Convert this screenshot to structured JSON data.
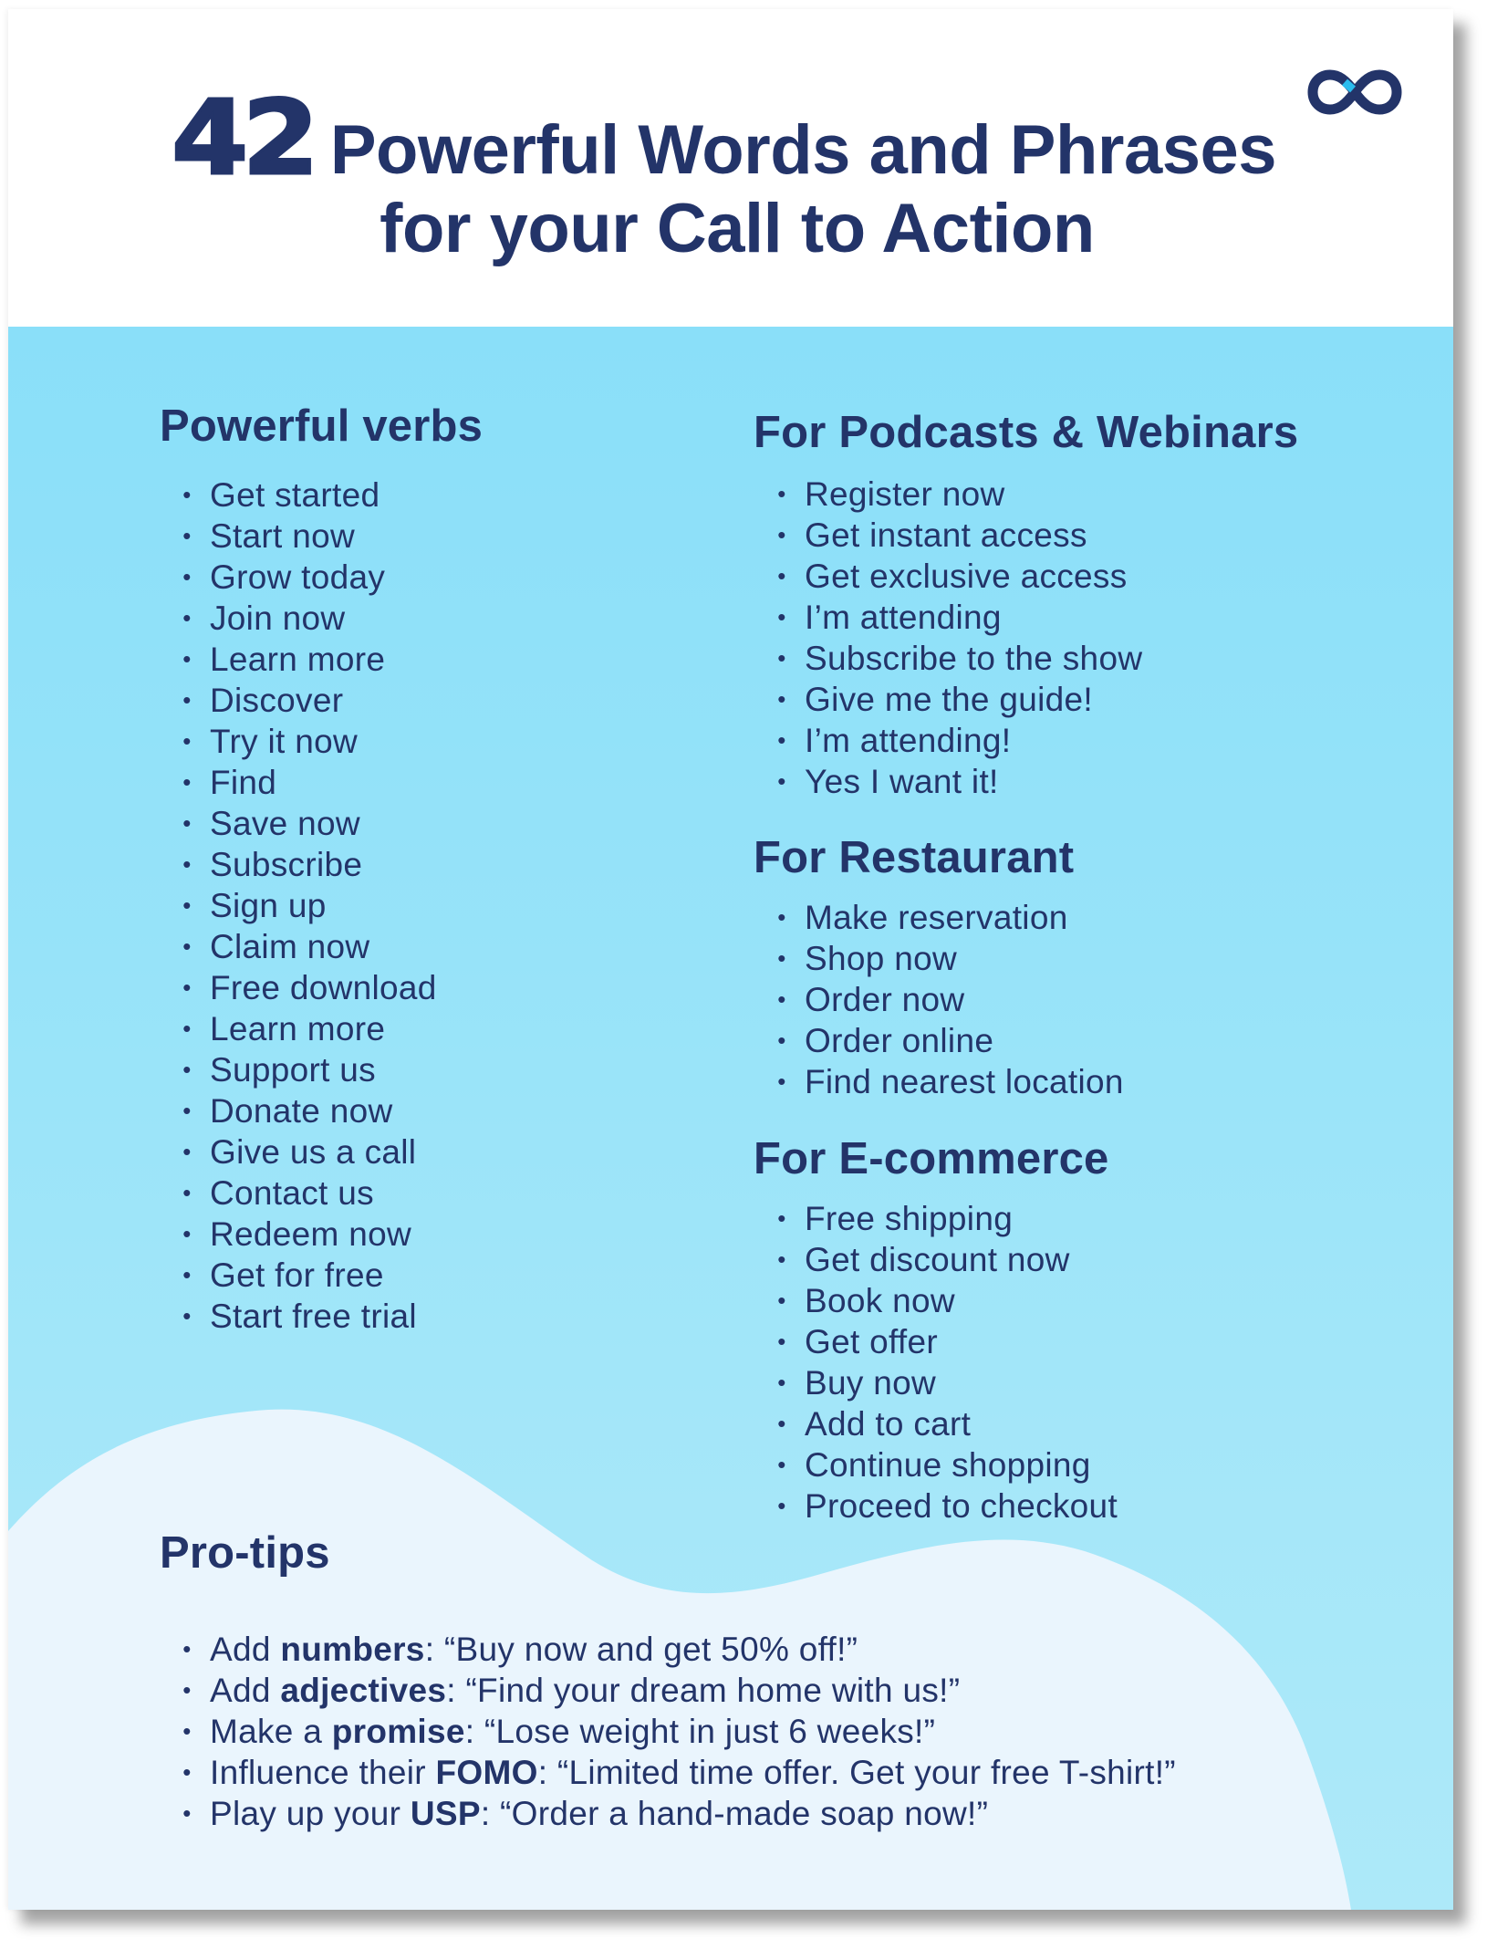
{
  "title": {
    "number": "42",
    "line1": "Powerful Words and Phrases",
    "line2": "for your Call to Action"
  },
  "logo": {
    "icon": "infinity-icon",
    "colors": {
      "primary": "#233469",
      "accent": "#2bbcee"
    }
  },
  "colors": {
    "text": "#233469",
    "header_bg": "#ffffff",
    "panel_top": "#8adff9",
    "panel_bottom": "#ade9f9",
    "wave": "#eaf5fd"
  },
  "sections": {
    "verbs": {
      "heading": "Powerful verbs",
      "items": [
        "Get started",
        "Start now",
        "Grow today",
        "Join now",
        "Learn more",
        "Discover",
        "Try it now",
        "Find",
        "Save now",
        "Subscribe",
        "Sign up",
        "Claim now",
        "Free download",
        "Learn more",
        "Support us",
        "Donate now",
        "Give us a call",
        "Contact us",
        "Redeem now",
        "Get for free",
        "Start free trial"
      ]
    },
    "podcasts": {
      "heading": "For Podcasts & Webinars",
      "items": [
        "Register now",
        "Get instant access",
        "Get exclusive access",
        "I’m attending",
        "Subscribe to the show",
        "Give me the guide!",
        "I’m attending!",
        "Yes I want it!"
      ]
    },
    "restaurant": {
      "heading": "For Restaurant",
      "items": [
        "Make reservation",
        "Shop now",
        "Order now",
        "Order online",
        "Find nearest location"
      ]
    },
    "ecommerce": {
      "heading": "For E-commerce",
      "items": [
        "Free shipping",
        "Get discount now",
        "Book now",
        "Get offer",
        "Buy now",
        "Add to cart",
        "Continue shopping",
        "Proceed to checkout"
      ]
    }
  },
  "protips": {
    "heading": "Pro-tips",
    "items": [
      {
        "prefix": "Add ",
        "keyword": "numbers",
        "suffix": ": “Buy now and get 50% off!”"
      },
      {
        "prefix": "Add ",
        "keyword": "adjectives",
        "suffix": ": “Find your dream home with us!”"
      },
      {
        "prefix": "Make a ",
        "keyword": "promise",
        "suffix": ": “Lose weight in just 6 weeks!”"
      },
      {
        "prefix": "Influence their ",
        "keyword": "FOMO",
        "suffix": ": “Limited time offer. Get your free T-shirt!”"
      },
      {
        "prefix": "Play up your ",
        "keyword": "USP",
        "suffix": ": “Order a hand-made soap now!”"
      }
    ]
  },
  "bullet_glyph": "•"
}
